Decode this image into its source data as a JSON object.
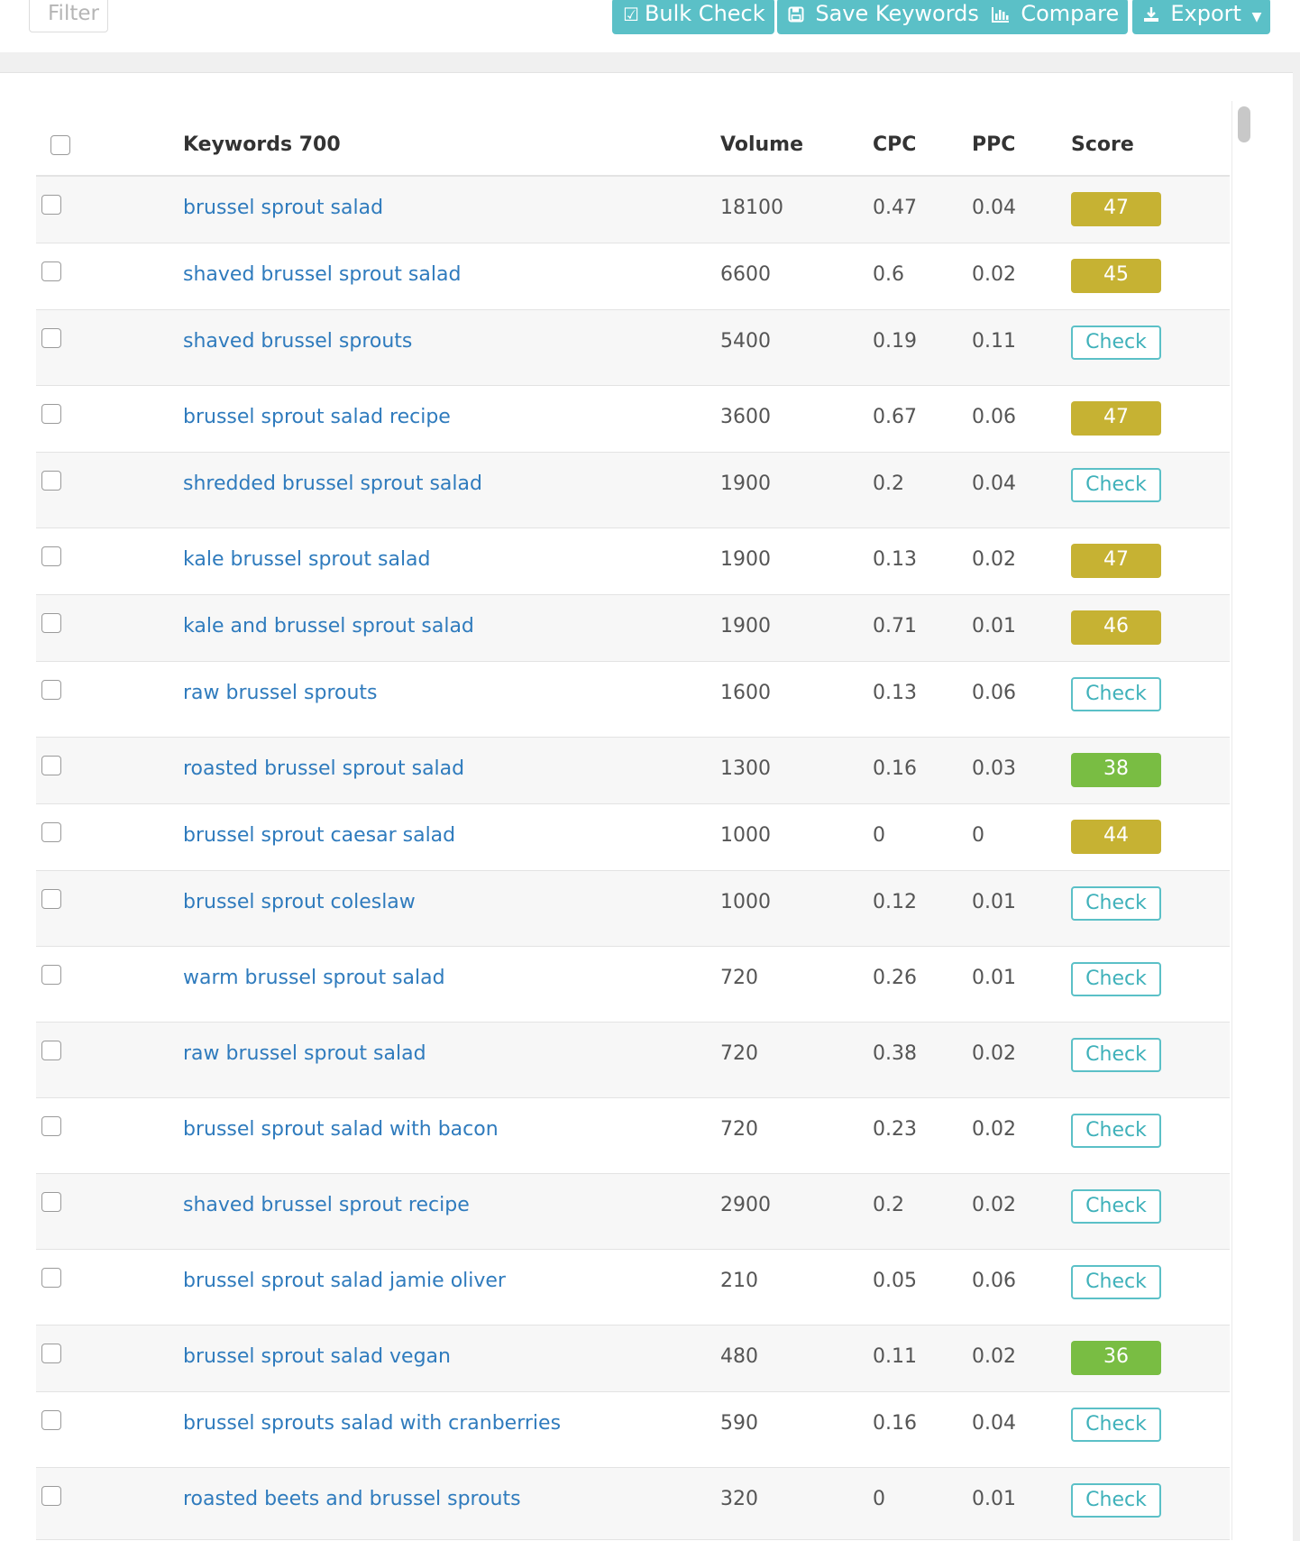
{
  "toolbar": {
    "filter_placeholder": "Filter",
    "bulk_check": "Bulk Check",
    "save_keywords": "Save Keywords",
    "compare": "Compare",
    "export": "Export"
  },
  "table": {
    "headers": {
      "keywords": "Keywords 700",
      "volume": "Volume",
      "cpc": "CPC",
      "ppc": "PPC",
      "score": "Score"
    },
    "rows": [
      {
        "keyword": "brussel sprout salad",
        "volume": "18100",
        "cpc": "0.47",
        "ppc": "0.04",
        "score": "47",
        "score_type": "yellow"
      },
      {
        "keyword": "shaved brussel sprout salad",
        "volume": "6600",
        "cpc": "0.6",
        "ppc": "0.02",
        "score": "45",
        "score_type": "yellow"
      },
      {
        "keyword": "shaved brussel sprouts",
        "volume": "5400",
        "cpc": "0.19",
        "ppc": "0.11",
        "score": "Check",
        "score_type": "check"
      },
      {
        "keyword": "brussel sprout salad recipe",
        "volume": "3600",
        "cpc": "0.67",
        "ppc": "0.06",
        "score": "47",
        "score_type": "yellow"
      },
      {
        "keyword": "shredded brussel sprout salad",
        "volume": "1900",
        "cpc": "0.2",
        "ppc": "0.04",
        "score": "Check",
        "score_type": "check"
      },
      {
        "keyword": "kale brussel sprout salad",
        "volume": "1900",
        "cpc": "0.13",
        "ppc": "0.02",
        "score": "47",
        "score_type": "yellow"
      },
      {
        "keyword": "kale and brussel sprout salad",
        "volume": "1900",
        "cpc": "0.71",
        "ppc": "0.01",
        "score": "46",
        "score_type": "yellow"
      },
      {
        "keyword": "raw brussel sprouts",
        "volume": "1600",
        "cpc": "0.13",
        "ppc": "0.06",
        "score": "Check",
        "score_type": "check"
      },
      {
        "keyword": "roasted brussel sprout salad",
        "volume": "1300",
        "cpc": "0.16",
        "ppc": "0.03",
        "score": "38",
        "score_type": "green"
      },
      {
        "keyword": "brussel sprout caesar salad",
        "volume": "1000",
        "cpc": "0",
        "ppc": "0",
        "score": "44",
        "score_type": "yellow"
      },
      {
        "keyword": "brussel sprout coleslaw",
        "volume": "1000",
        "cpc": "0.12",
        "ppc": "0.01",
        "score": "Check",
        "score_type": "check"
      },
      {
        "keyword": "warm brussel sprout salad",
        "volume": "720",
        "cpc": "0.26",
        "ppc": "0.01",
        "score": "Check",
        "score_type": "check"
      },
      {
        "keyword": "raw brussel sprout salad",
        "volume": "720",
        "cpc": "0.38",
        "ppc": "0.02",
        "score": "Check",
        "score_type": "check"
      },
      {
        "keyword": "brussel sprout salad with bacon",
        "volume": "720",
        "cpc": "0.23",
        "ppc": "0.02",
        "score": "Check",
        "score_type": "check"
      },
      {
        "keyword": "shaved brussel sprout recipe",
        "volume": "2900",
        "cpc": "0.2",
        "ppc": "0.02",
        "score": "Check",
        "score_type": "check"
      },
      {
        "keyword": "brussel sprout salad jamie oliver",
        "volume": "210",
        "cpc": "0.05",
        "ppc": "0.06",
        "score": "Check",
        "score_type": "check"
      },
      {
        "keyword": "brussel sprout salad vegan",
        "volume": "480",
        "cpc": "0.11",
        "ppc": "0.02",
        "score": "36",
        "score_type": "green"
      },
      {
        "keyword": "brussel sprouts salad with cranberries",
        "volume": "590",
        "cpc": "0.16",
        "ppc": "0.04",
        "score": "Check",
        "score_type": "check"
      },
      {
        "keyword": "roasted beets and brussel sprouts",
        "volume": "320",
        "cpc": "0",
        "ppc": "0.01",
        "score": "Check",
        "score_type": "check"
      }
    ]
  },
  "colors": {
    "accent": "#5bc0c7",
    "score_yellow": "#c6b233",
    "score_green": "#79bd43",
    "link": "#2f7bbd"
  },
  "icons": {
    "bulk_check": "check-square-icon",
    "save_keywords": "floppy-disk-icon",
    "compare": "bar-chart-icon",
    "export": "download-icon",
    "export_caret": "caret-down-icon"
  }
}
